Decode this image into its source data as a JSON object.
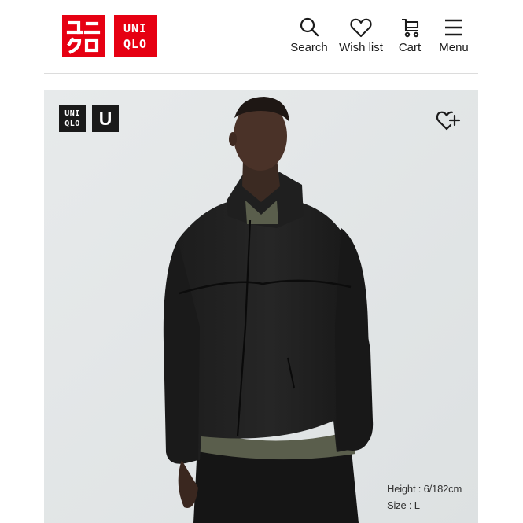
{
  "brand": {
    "logo_jp_text": "ユニクロ",
    "logo_en_line1": "UNI",
    "logo_en_line2": "QLO",
    "color": "#e60012"
  },
  "nav": {
    "items": [
      {
        "label": "Search",
        "icon": "search-icon"
      },
      {
        "label": "Wish list",
        "icon": "heart-icon"
      },
      {
        "label": "Cart",
        "icon": "cart-icon"
      },
      {
        "label": "Menu",
        "icon": "menu-icon"
      }
    ]
  },
  "product": {
    "badge_line1": "UNI",
    "badge_line2": "QLO",
    "badge_u": "U",
    "favorite_icon": "heart-plus-icon",
    "height_text": "Height : 6/182cm",
    "size_text": "Size : L",
    "background": "#e4e7e8"
  }
}
